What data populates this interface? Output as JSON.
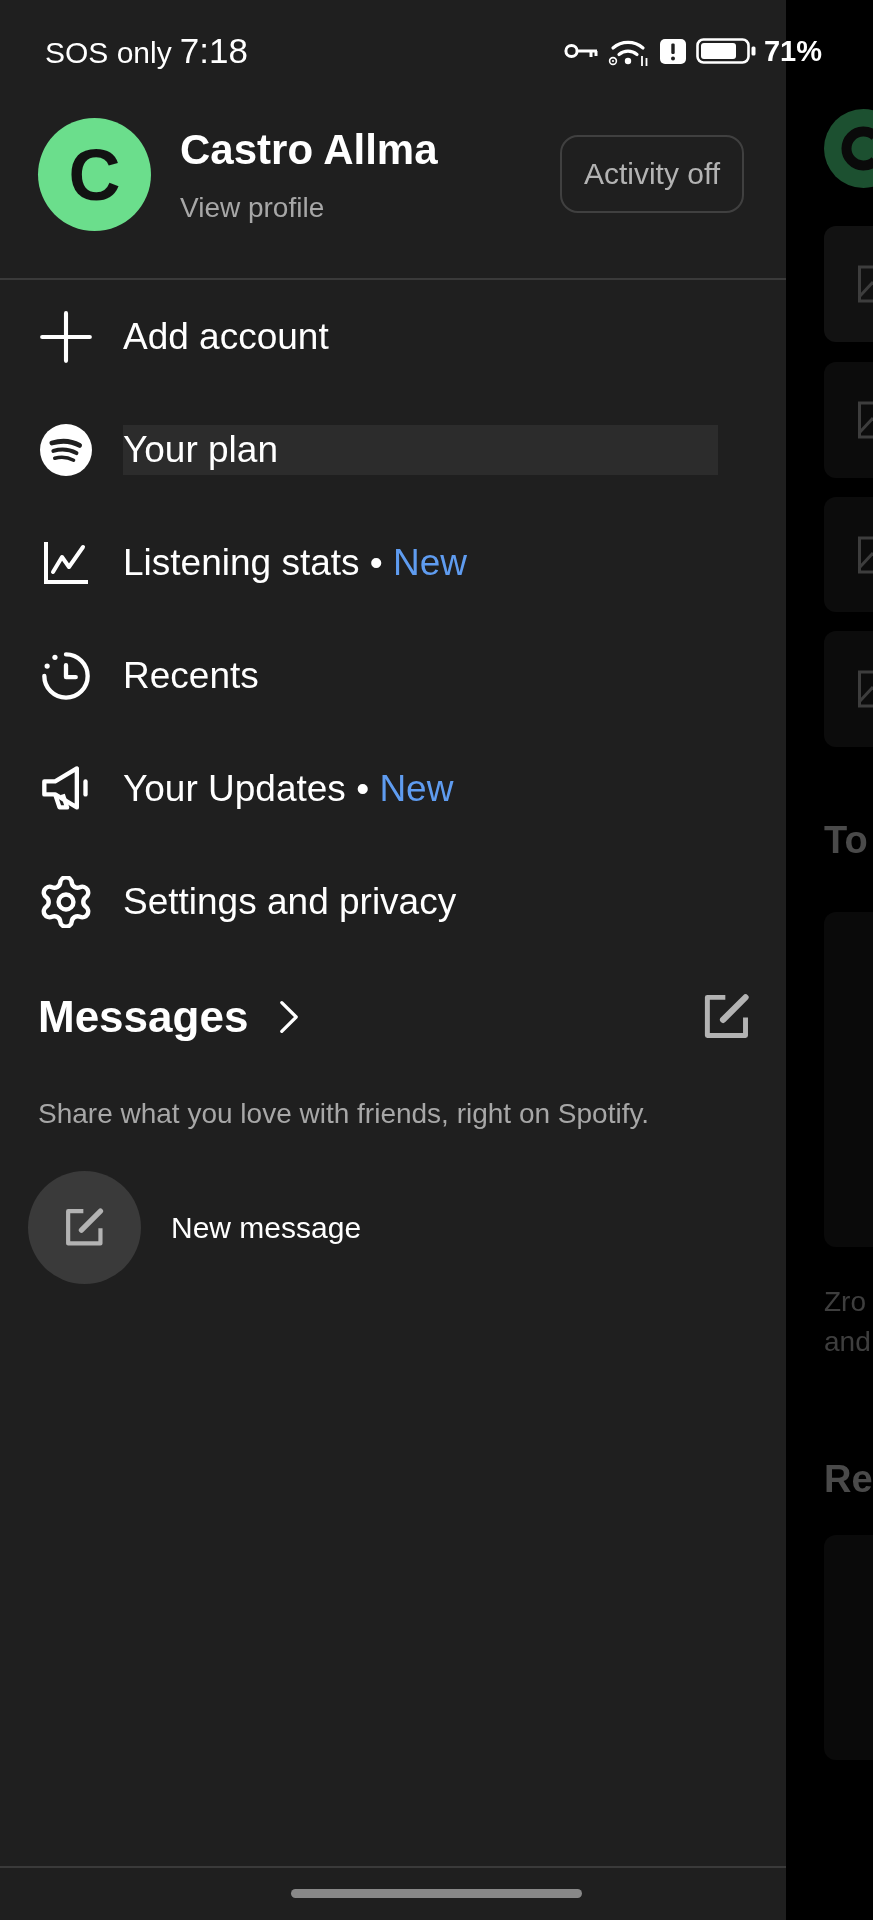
{
  "status_bar": {
    "carrier": "SOS only",
    "time": "7:18",
    "battery": "71%"
  },
  "profile": {
    "initial": "C",
    "name": "Castro Allma",
    "link": "View profile",
    "activity_button": "Activity off"
  },
  "menu": [
    {
      "label": "Add account",
      "selected": false
    },
    {
      "label": "Your plan",
      "selected": true
    },
    {
      "label": "Listening stats",
      "separator": "•",
      "badge": "New",
      "selected": false
    },
    {
      "label": "Recents",
      "selected": false
    },
    {
      "label": "Your Updates",
      "separator": "•",
      "badge": "New",
      "selected": false
    },
    {
      "label": "Settings and privacy",
      "selected": false
    }
  ],
  "messages": {
    "title": "Messages",
    "description": "Share what you love with friends, right on Spotify.",
    "new_message": "New message"
  },
  "background_page": {
    "section_title_1": "To",
    "caption_lines": [
      "Zro",
      "and"
    ],
    "section_title_2": "Re"
  }
}
